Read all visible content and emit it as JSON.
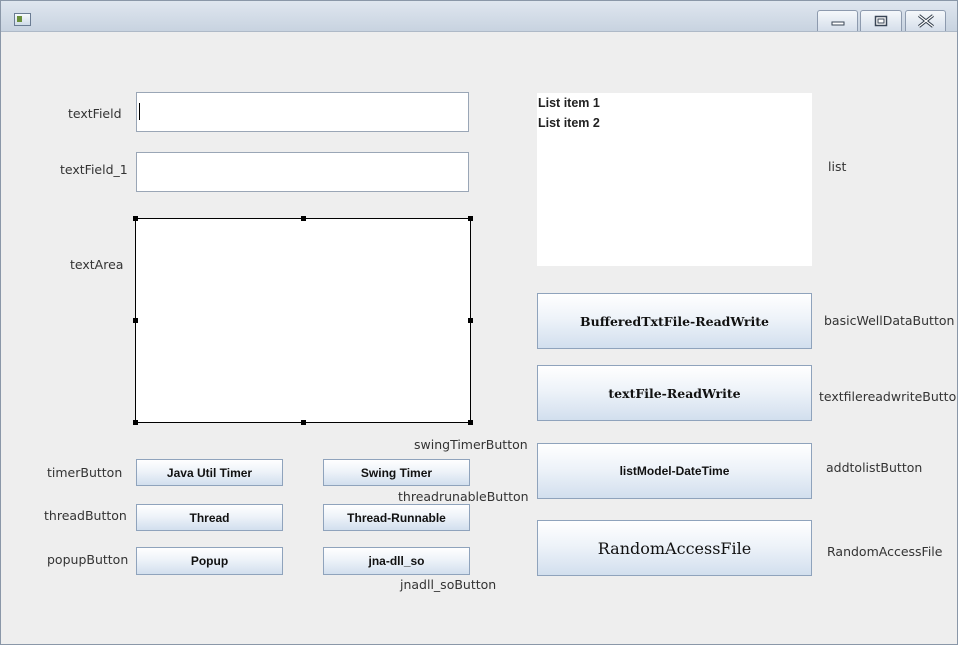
{
  "window": {
    "icon": "java-app-icon",
    "controls": [
      "minimize-icon",
      "maximize-icon",
      "close-icon"
    ]
  },
  "labels": {
    "textField": "textField",
    "textField_1": "textField_1",
    "textArea": "textArea",
    "timerButton": "timerButton",
    "threadButton": "threadButton",
    "popupButton": "popupButton",
    "swingTimerButton": "swingTimerButton",
    "threadrunableButton": "threadrunableButton",
    "jnadll_soButton": "jnadll_soButton",
    "list": "list",
    "basicWellDataButton": "basicWellDataButton",
    "textfilereadwriteButton": "textfilereadwriteButton",
    "addtolistButton": "addtolistButton",
    "RandomAccessFile": "RandomAccessFile"
  },
  "fields": {
    "textField": {
      "value": ""
    },
    "textField_1": {
      "value": ""
    },
    "textArea": {
      "value": ""
    }
  },
  "list": {
    "items": [
      "List item 1",
      "List item 2"
    ]
  },
  "buttons": {
    "java_util_timer": "Java Util Timer",
    "swing_timer": "Swing Timer",
    "thread": "Thread",
    "thread_runnable": "Thread-Runnable",
    "popup": "Popup",
    "jna_dll_so": "jna-dll_so",
    "buffered_txt_file": "BufferedTxtFile-ReadWrite",
    "text_file_readwrite": "textFile-ReadWrite",
    "list_model_datetime": "listModel-DateTime",
    "random_access_file": "RandomAccessFile"
  },
  "colors": {
    "button_border": "#8fa3bc",
    "titlebar": "#c8d3e0",
    "panel_background": "#eeeeee"
  }
}
